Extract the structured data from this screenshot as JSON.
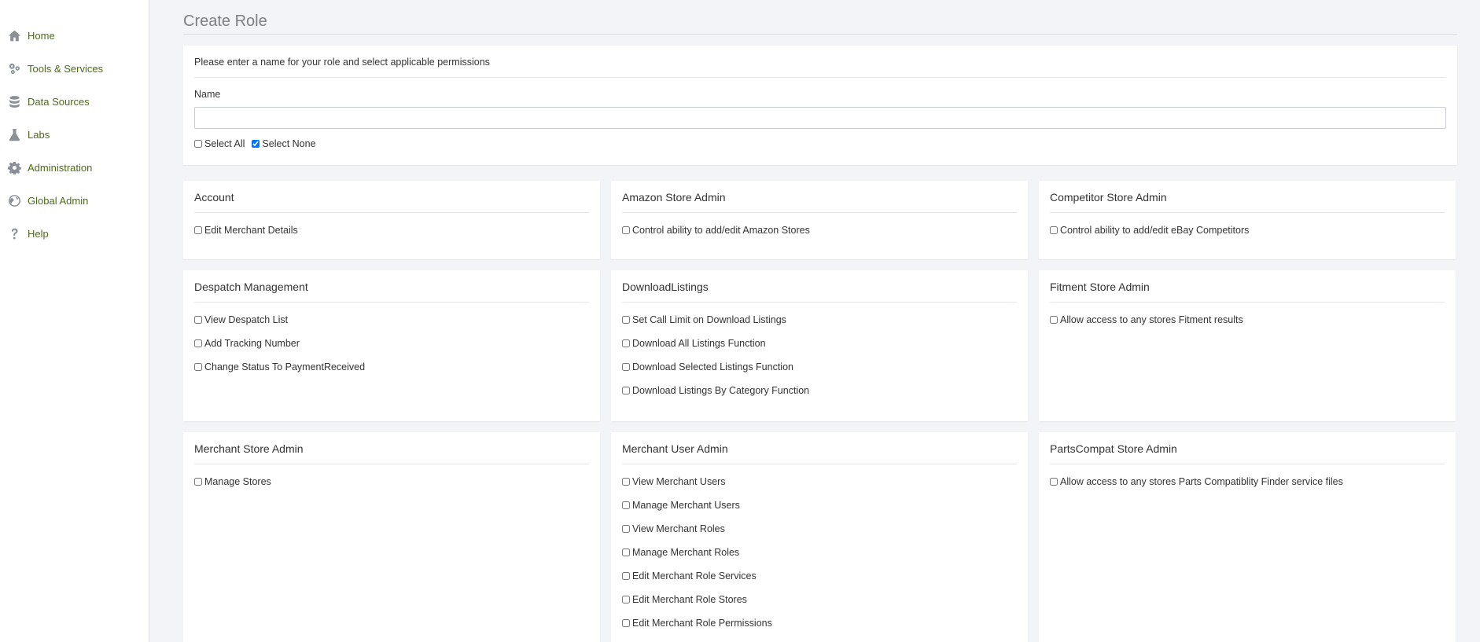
{
  "sidebar": {
    "items": [
      {
        "label": "Home",
        "icon": "home-icon"
      },
      {
        "label": "Tools & Services",
        "icon": "tools-icon"
      },
      {
        "label": "Data Sources",
        "icon": "database-icon"
      },
      {
        "label": "Labs",
        "icon": "flask-icon"
      },
      {
        "label": "Administration",
        "icon": "gear-icon"
      },
      {
        "label": "Global Admin",
        "icon": "globe-icon"
      },
      {
        "label": "Help",
        "icon": "question-icon"
      }
    ]
  },
  "page": {
    "title": "Create Role",
    "intro": "Please enter a name for your role and select applicable permissions",
    "name_label": "Name",
    "name_value": "",
    "select_all_label": "Select All",
    "select_none_label": "Select None",
    "select_all_checked": false,
    "select_none_checked": true
  },
  "groups": [
    {
      "title": "Account",
      "permissions": [
        "Edit Merchant Details"
      ]
    },
    {
      "title": "Amazon Store Admin",
      "permissions": [
        "Control ability to add/edit Amazon Stores"
      ]
    },
    {
      "title": "Competitor Store Admin",
      "permissions": [
        "Control ability to add/edit eBay Competitors"
      ]
    },
    {
      "title": "Despatch Management",
      "permissions": [
        "View Despatch List",
        "Add Tracking Number",
        "Change Status To PaymentReceived"
      ]
    },
    {
      "title": "DownloadListings",
      "permissions": [
        "Set Call Limit on Download Listings",
        "Download All Listings Function",
        "Download Selected Listings Function",
        "Download Listings By Category Function"
      ]
    },
    {
      "title": "Fitment Store Admin",
      "permissions": [
        "Allow access to any stores Fitment results"
      ]
    },
    {
      "title": "Merchant Store Admin",
      "permissions": [
        "Manage Stores"
      ]
    },
    {
      "title": "Merchant User Admin",
      "permissions": [
        "View Merchant Users",
        "Manage Merchant Users",
        "View Merchant Roles",
        "Manage Merchant Roles",
        "Edit Merchant Role Services",
        "Edit Merchant Role Stores",
        "Edit Merchant Role Permissions"
      ]
    },
    {
      "title": "PartsCompat Store Admin",
      "permissions": [
        "Allow access to any stores Parts Compatiblity Finder service files"
      ]
    }
  ],
  "colors": {
    "nav_text": "#4c6b13",
    "background": "#f2f4f7",
    "checkbox_accent": "#1a73e8"
  }
}
